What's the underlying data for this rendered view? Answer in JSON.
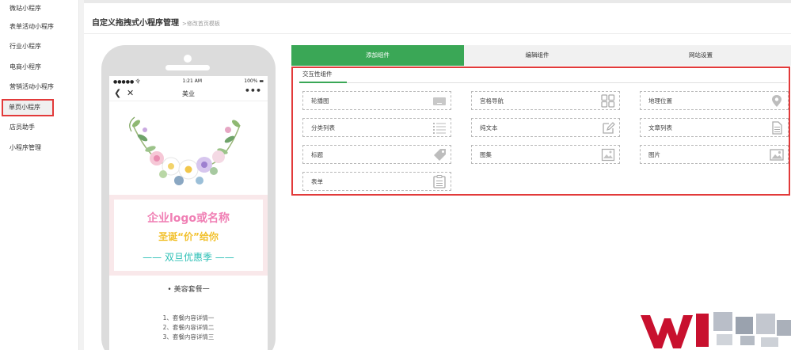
{
  "sidebar": {
    "items": [
      {
        "label": "微站小程序"
      },
      {
        "label": "表单活动小程序"
      },
      {
        "label": "行业小程序"
      },
      {
        "label": "电商小程序"
      },
      {
        "label": "营销活动小程序"
      },
      {
        "label": "单页小程序",
        "active": true
      },
      {
        "label": "店员助手"
      },
      {
        "label": "小程序管理"
      }
    ]
  },
  "header": {
    "title": "自定义拖拽式小程序管理",
    "subtitle": ">修改首页模板"
  },
  "phone": {
    "status": {
      "signal": "●●●●● 令",
      "time": "1:21 AM",
      "battery": "100% ▬"
    },
    "nav": {
      "back": "❮",
      "close": "✕",
      "title": "美业",
      "more": "•••"
    },
    "promo": {
      "company": "企业logo或名称",
      "slogan": "圣诞“价”给你",
      "season": "—— 双旦优惠季 ——"
    },
    "package_title": "• 美容套餐一",
    "package_items": [
      "1、套餐内容详情一",
      "2、套餐内容详情二",
      "3、套餐内容详情三"
    ]
  },
  "tabs": [
    {
      "label": "添加组件",
      "active": true
    },
    {
      "label": "编辑组件"
    },
    {
      "label": "网站设置"
    }
  ],
  "components": {
    "group_label": "交互性组件",
    "items": [
      {
        "label": "轮播图",
        "icon": "carousel-icon"
      },
      {
        "label": "宫格导航",
        "icon": "grid-icon"
      },
      {
        "label": "地理位置",
        "icon": "location-pin-icon"
      },
      {
        "label": "分类列表",
        "icon": "list-icon"
      },
      {
        "label": "纯文本",
        "icon": "edit-icon"
      },
      {
        "label": "文章列表",
        "icon": "document-icon"
      },
      {
        "label": "标题",
        "icon": "tag-icon"
      },
      {
        "label": "图集",
        "icon": "gallery-icon"
      },
      {
        "label": "图片",
        "icon": "image-icon"
      },
      {
        "label": "表单",
        "icon": "form-icon"
      }
    ]
  },
  "colors": {
    "accent_green": "#3aa756",
    "highlight_red": "#e23a3a",
    "brand_red": "#c8102e"
  }
}
